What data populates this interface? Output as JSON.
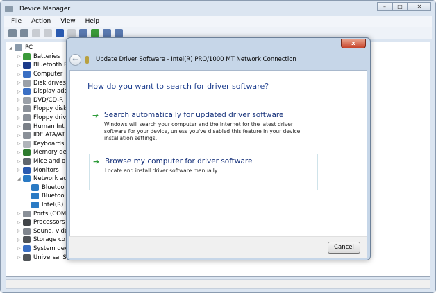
{
  "window": {
    "title": "Device Manager",
    "controls": [
      "minimize",
      "maximize",
      "close"
    ]
  },
  "menu": [
    "File",
    "Action",
    "View",
    "Help"
  ],
  "toolbar_icons": [
    "back-icon",
    "forward-icon",
    "properties-icon",
    "console-icon",
    "help-icon",
    "view-icon",
    "scan-icon",
    "update-driver-icon",
    "disable-icon",
    "uninstall-icon"
  ],
  "tree": {
    "root": "PC",
    "items": [
      {
        "label": "Batteries",
        "level": 1,
        "expanded": false,
        "color": "#3a9a3a"
      },
      {
        "label": "Bluetooth R",
        "level": 1,
        "expanded": false,
        "color": "#1a3a8a"
      },
      {
        "label": "Computer",
        "level": 1,
        "expanded": false,
        "color": "#3a6fc4"
      },
      {
        "label": "Disk drives",
        "level": 1,
        "expanded": false,
        "color": "#9aa0a8"
      },
      {
        "label": "Display ada",
        "level": 1,
        "expanded": false,
        "color": "#3a6fc4"
      },
      {
        "label": "DVD/CD-R",
        "level": 1,
        "expanded": false,
        "color": "#9aa0a8"
      },
      {
        "label": "Floppy disk",
        "level": 1,
        "expanded": false,
        "color": "#8a9098"
      },
      {
        "label": "Floppy driv",
        "level": 1,
        "expanded": false,
        "color": "#8a9098"
      },
      {
        "label": "Human Int",
        "level": 1,
        "expanded": false,
        "color": "#7a8088"
      },
      {
        "label": "IDE ATA/AT",
        "level": 1,
        "expanded": false,
        "color": "#8a9098"
      },
      {
        "label": "Keyboards",
        "level": 1,
        "expanded": false,
        "color": "#b0b4ba"
      },
      {
        "label": "Memory de",
        "level": 1,
        "expanded": false,
        "color": "#2d7a2d"
      },
      {
        "label": "Mice and o",
        "level": 1,
        "expanded": false,
        "color": "#60666e"
      },
      {
        "label": "Monitors",
        "level": 1,
        "expanded": false,
        "color": "#2a5ab0"
      },
      {
        "label": "Network ad",
        "level": 1,
        "expanded": true,
        "color": "#2a7ac4"
      },
      {
        "label": "Bluetoo",
        "level": 2,
        "expanded": null,
        "color": "#2a7ac4"
      },
      {
        "label": "Bluetoo",
        "level": 2,
        "expanded": null,
        "color": "#2a7ac4"
      },
      {
        "label": "Intel(R)",
        "level": 2,
        "expanded": null,
        "color": "#2a7ac4"
      },
      {
        "label": "Ports (COM",
        "level": 1,
        "expanded": false,
        "color": "#8a9098"
      },
      {
        "label": "Processors",
        "level": 1,
        "expanded": false,
        "color": "#404448"
      },
      {
        "label": "Sound, vide",
        "level": 1,
        "expanded": false,
        "color": "#80868e"
      },
      {
        "label": "Storage co",
        "level": 1,
        "expanded": false,
        "color": "#505458"
      },
      {
        "label": "System dev",
        "level": 1,
        "expanded": false,
        "color": "#3a6fc4"
      },
      {
        "label": "Universal S",
        "level": 1,
        "expanded": false,
        "color": "#505458"
      }
    ]
  },
  "dialog": {
    "title": "Update Driver Software - Intel(R) PRO/1000 MT Network Connection",
    "question": "How do you want to search for driver software?",
    "options": [
      {
        "title": "Search automatically for updated driver software",
        "desc": "Windows will search your computer and the Internet for the latest driver software for your device, unless you've disabled this feature in your device installation settings."
      },
      {
        "title": "Browse my computer for driver software",
        "desc": "Locate and install driver software manually."
      }
    ],
    "cancel": "Cancel",
    "close": "x"
  }
}
